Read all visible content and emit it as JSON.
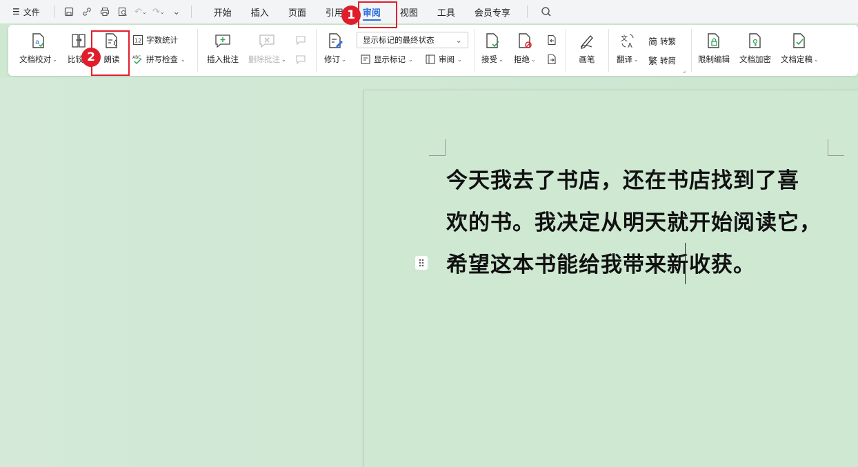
{
  "menubar": {
    "file_label": "文件",
    "tabs": [
      "开始",
      "插入",
      "页面",
      "引用",
      "审阅",
      "视图",
      "工具",
      "会员专享"
    ],
    "active_tab": "审阅"
  },
  "ribbon": {
    "doc_proof": "文档校对",
    "compare": "比较",
    "read_aloud": "朗读",
    "word_count": "字数统计",
    "spell_check": "拼写检查",
    "insert_comment": "插入批注",
    "delete_comment": "删除批注",
    "track_changes": "修订",
    "markup_mode": "显示标记的最终状态",
    "show_markup": "显示标记",
    "review_pane": "审阅",
    "accept": "接受",
    "reject": "拒绝",
    "pen": "画笔",
    "translate": "翻译",
    "to_traditional": "转繁",
    "to_simplified": "转简",
    "restrict_edit": "限制编辑",
    "encrypt": "文档加密",
    "finalize": "文档定稿"
  },
  "annotations": {
    "badge1": "1",
    "badge2": "2"
  },
  "document": {
    "line1": "今天我去了书店，还在书店找到了喜",
    "line2": "欢的书。我决定从明天就开始阅读它，",
    "line3": "希望这本书能给我带来新收获。"
  },
  "colors": {
    "accent": "#2e6fe0",
    "highlight": "#e01e2b",
    "page_bg": "#cfe8d2"
  }
}
